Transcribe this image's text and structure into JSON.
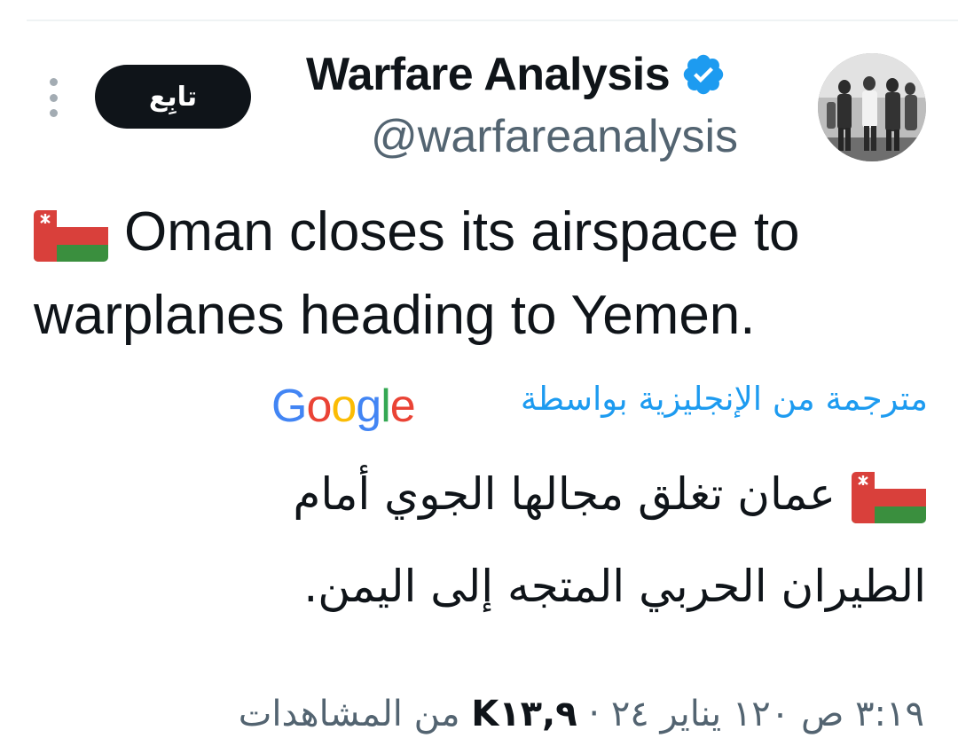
{
  "author": {
    "display_name": "Warfare Analysis",
    "handle": "@warfareanalysis",
    "verified_icon": "verified-badge-icon",
    "avatar": "avatar-photo"
  },
  "actions": {
    "follow_label": "تابِع",
    "more_icon": "more-vertical-icon"
  },
  "tweet": {
    "flag_icon": "oman-flag-emoji",
    "line1": "Oman closes its airspace to",
    "line2": "warplanes heading to Yemen."
  },
  "translation": {
    "label": "مترجمة من الإنجليزية بواسطة",
    "provider": "Google",
    "line1": "عمان تغلق مجالها الجوي أمام",
    "line2": "الطيران الحربي المتجه إلى اليمن."
  },
  "meta": {
    "time": "٣:١٩ ص",
    "date": "١٢٠ يناير ٢٤",
    "views_count": "K١٣,٩",
    "views_label": "من المشاهدات"
  },
  "colors": {
    "link_blue": "#1d9bf0",
    "text_dark": "#0f1419",
    "text_gray": "#536471"
  }
}
